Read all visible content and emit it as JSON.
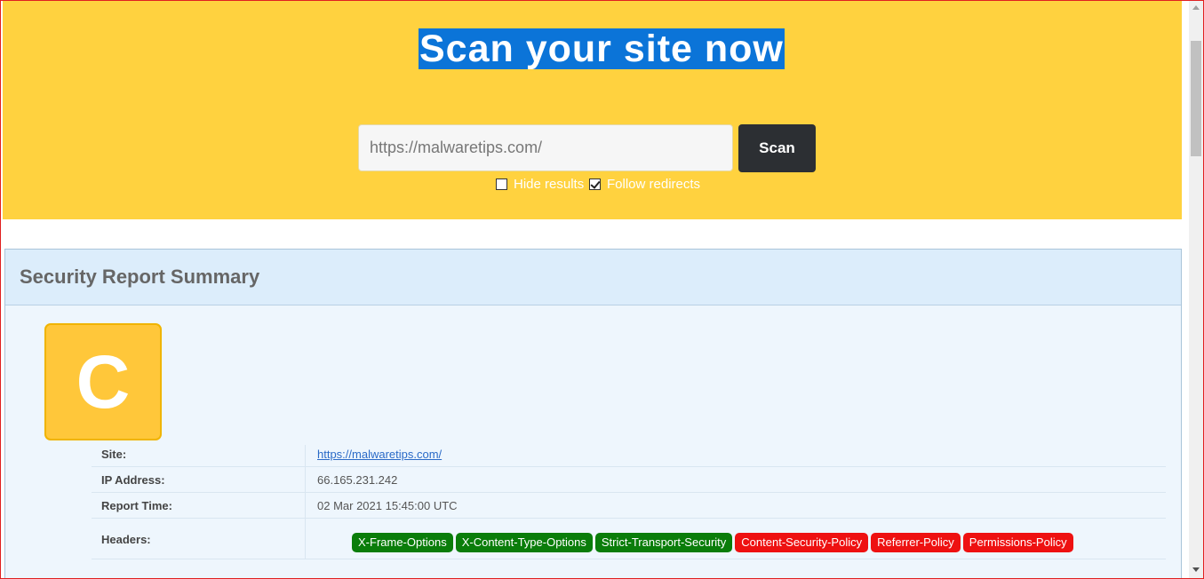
{
  "hero": {
    "title": "Scan your site now",
    "input_value": "https://malwaretips.com/",
    "scan_label": "Scan",
    "options": [
      {
        "label": "Hide results",
        "checked": false
      },
      {
        "label": "Follow redirects",
        "checked": true
      }
    ]
  },
  "report": {
    "title": "Security Report Summary",
    "grade": "C",
    "rows": [
      {
        "label": "Site:",
        "value": "https://malwaretips.com/"
      },
      {
        "label": "IP Address:",
        "value": "66.165.231.242"
      },
      {
        "label": "Report Time:",
        "value": "02 Mar 2021 15:45:00 UTC"
      },
      {
        "label": "Headers:"
      }
    ],
    "headers": [
      {
        "name": "X-Frame-Options",
        "status": "present"
      },
      {
        "name": "X-Content-Type-Options",
        "status": "present"
      },
      {
        "name": "Strict-Transport-Security",
        "status": "present"
      },
      {
        "name": "Content-Security-Policy",
        "status": "missing"
      },
      {
        "name": "Referrer-Policy",
        "status": "missing"
      },
      {
        "name": "Permissions-Policy",
        "status": "missing"
      }
    ]
  },
  "colors": {
    "hero_bg": "#ffd23f",
    "title_highlight": "#0b74d8",
    "grade_bg": "#ffc73a",
    "present": "#0a7d0a",
    "missing": "#ee1111"
  }
}
